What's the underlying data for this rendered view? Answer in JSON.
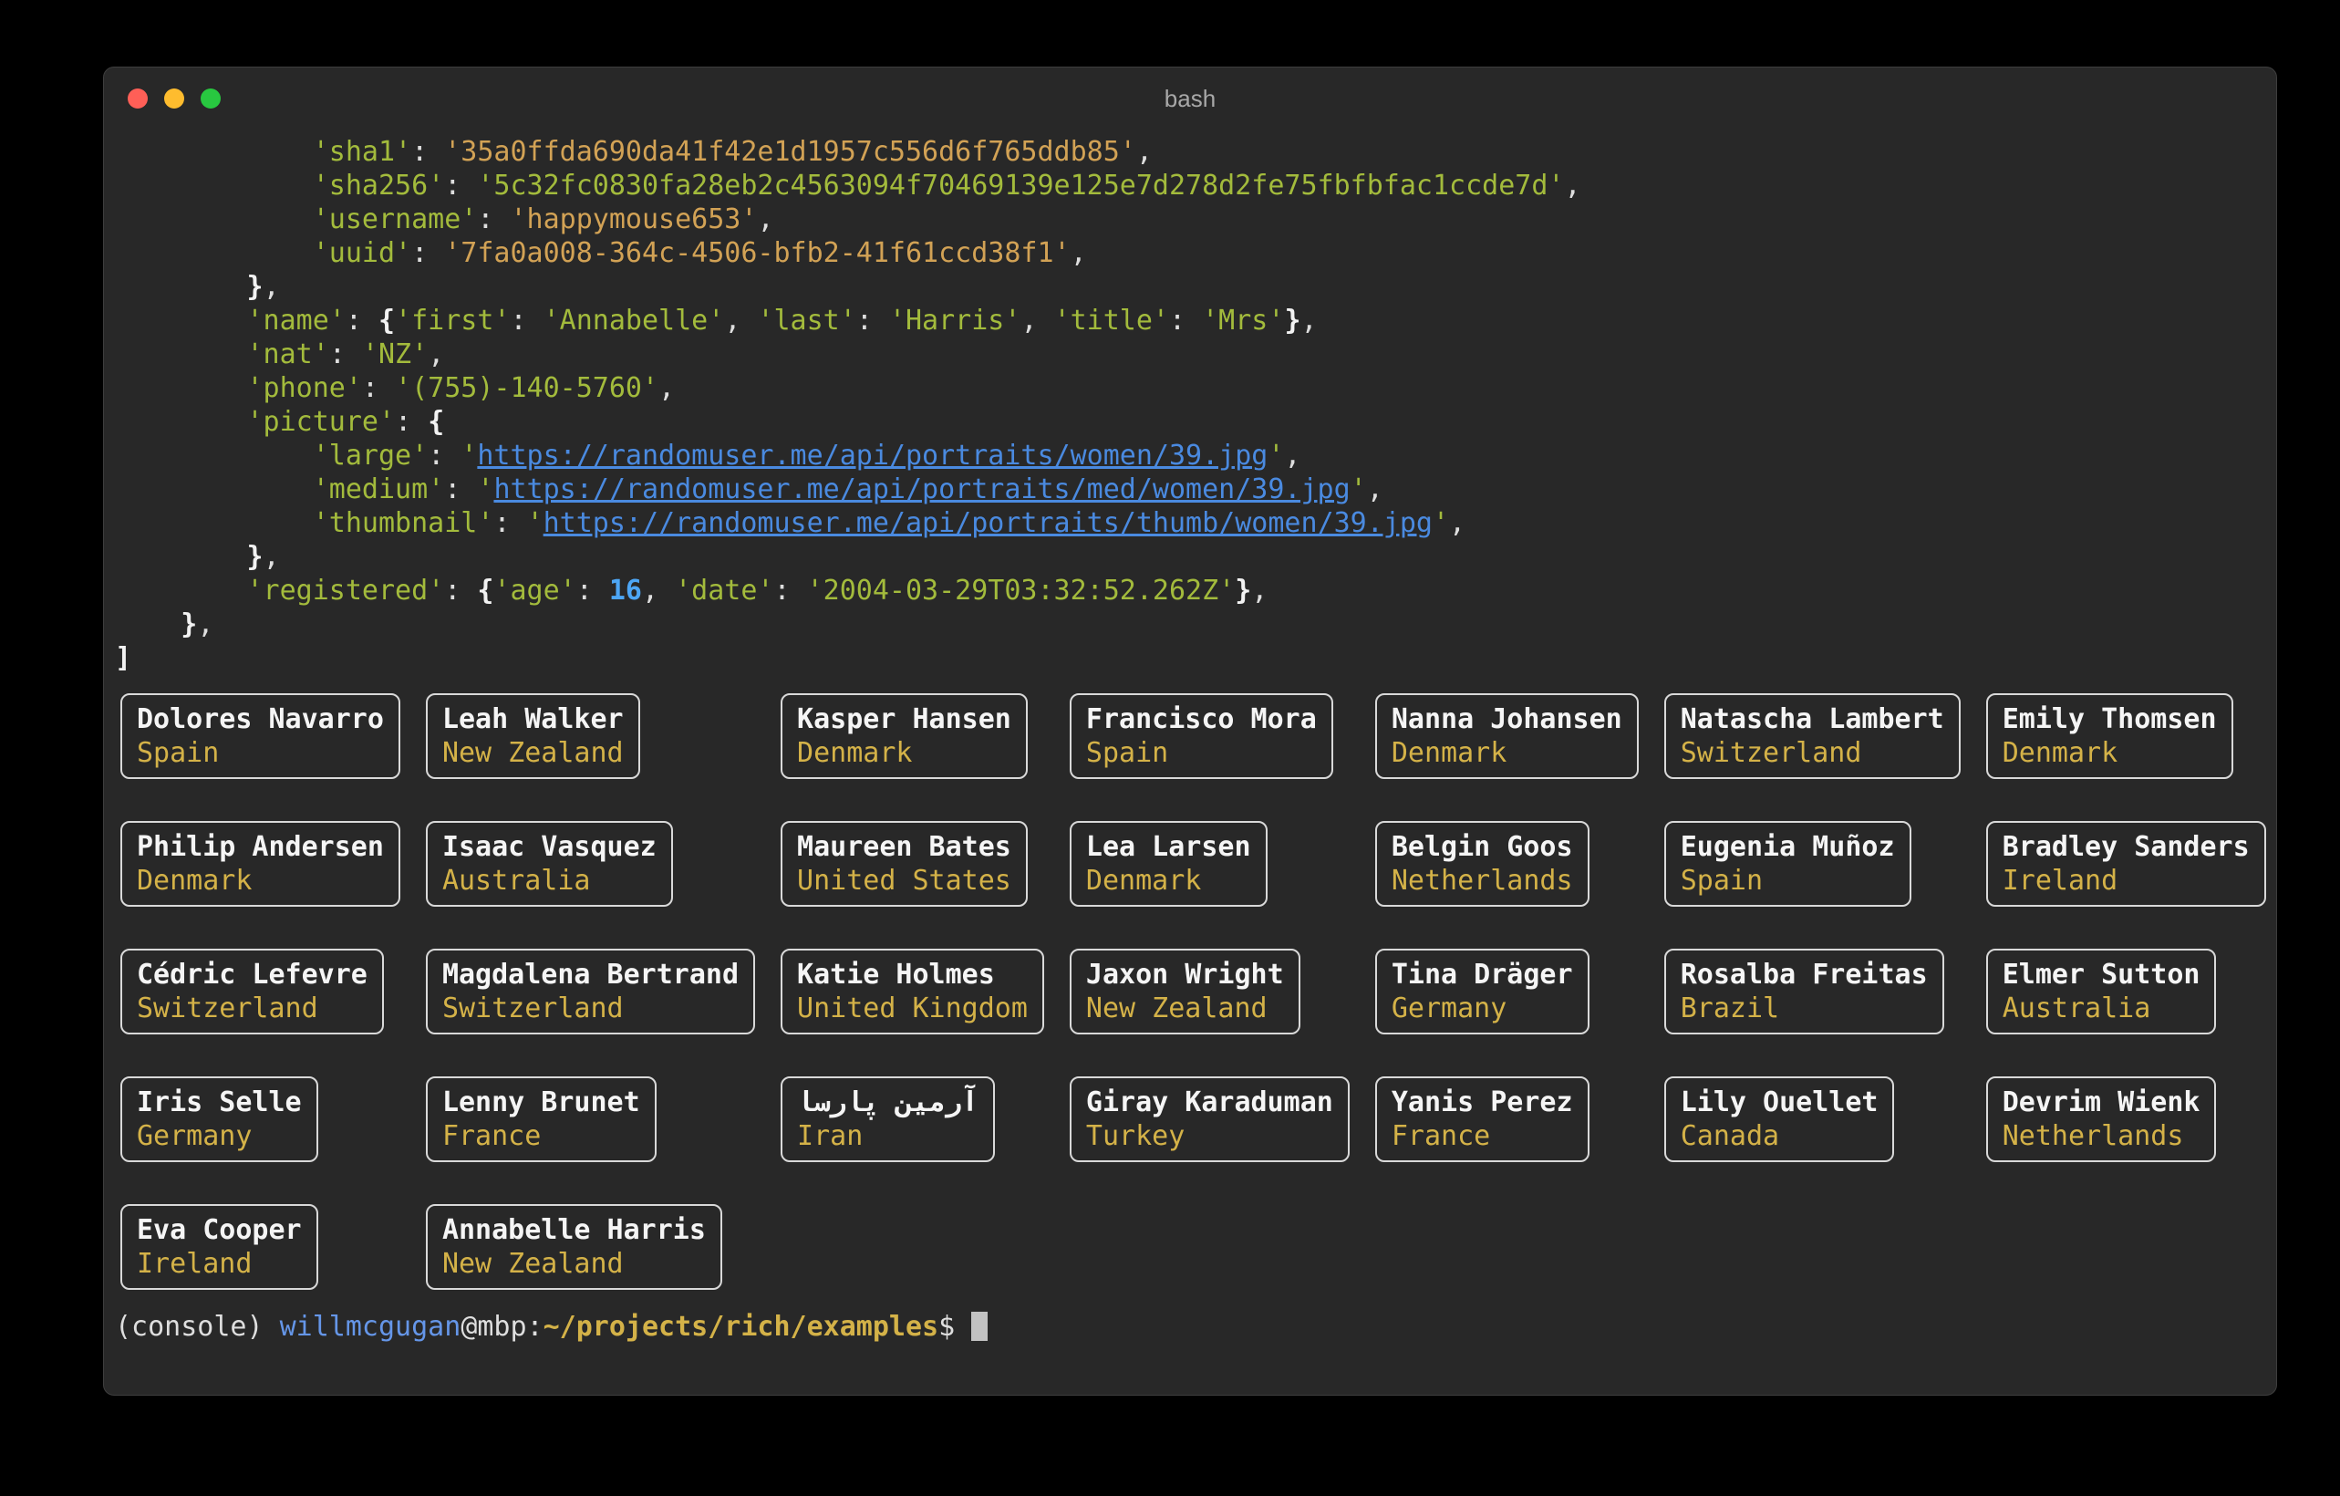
{
  "window": {
    "title": "bash"
  },
  "colors": {
    "background": "#000000",
    "terminal_bg": "#282828",
    "foreground": "#dedede",
    "green": "#a3bb3c",
    "amber": "#d2a255",
    "gold": "#d4b248",
    "number_blue": "#4da6f5",
    "url_blue": "#4a8ae0",
    "user_blue": "#6596e8",
    "card_border": "#d9d9d9",
    "name_white": "#f5f5f5",
    "title_gray": "#a8a8a8",
    "cursor": "#c2c2c2",
    "traffic_red": "#ff5f57",
    "traffic_yellow": "#febc2e",
    "traffic_green": "#28c840"
  },
  "terminal": {
    "output_lines": [
      [
        {
          "s": "plain",
          "t": "            "
        },
        {
          "s": "key",
          "t": "'sha1'"
        },
        {
          "s": "plain",
          "t": ": "
        },
        {
          "s": "amber",
          "t": "'35a0ffda690da41f42e1d1957c556d6f765ddb85'"
        },
        {
          "s": "plain",
          "t": ","
        }
      ],
      [
        {
          "s": "plain",
          "t": "            "
        },
        {
          "s": "key",
          "t": "'sha256'"
        },
        {
          "s": "plain",
          "t": ": "
        },
        {
          "s": "str",
          "t": "'5c32fc0830fa28eb2c4563094f70469139e125e7d278d2fe75fbfbfac1ccde7d'"
        },
        {
          "s": "plain",
          "t": ","
        }
      ],
      [
        {
          "s": "plain",
          "t": "            "
        },
        {
          "s": "key",
          "t": "'username'"
        },
        {
          "s": "plain",
          "t": ": "
        },
        {
          "s": "amber",
          "t": "'happymouse653'"
        },
        {
          "s": "plain",
          "t": ","
        }
      ],
      [
        {
          "s": "plain",
          "t": "            "
        },
        {
          "s": "key",
          "t": "'uuid'"
        },
        {
          "s": "plain",
          "t": ": "
        },
        {
          "s": "amber",
          "t": "'7fa0a008-364c-4506-bfb2-41f61ccd38f1'"
        },
        {
          "s": "plain",
          "t": ","
        }
      ],
      [
        {
          "s": "plain",
          "t": "        "
        },
        {
          "s": "brace",
          "t": "}"
        },
        {
          "s": "plain",
          "t": ","
        }
      ],
      [
        {
          "s": "plain",
          "t": "        "
        },
        {
          "s": "key",
          "t": "'name'"
        },
        {
          "s": "plain",
          "t": ": "
        },
        {
          "s": "brace",
          "t": "{"
        },
        {
          "s": "key",
          "t": "'first'"
        },
        {
          "s": "plain",
          "t": ": "
        },
        {
          "s": "str",
          "t": "'Annabelle'"
        },
        {
          "s": "plain",
          "t": ", "
        },
        {
          "s": "key",
          "t": "'last'"
        },
        {
          "s": "plain",
          "t": ": "
        },
        {
          "s": "str",
          "t": "'Harris'"
        },
        {
          "s": "plain",
          "t": ", "
        },
        {
          "s": "key",
          "t": "'title'"
        },
        {
          "s": "plain",
          "t": ": "
        },
        {
          "s": "str",
          "t": "'Mrs'"
        },
        {
          "s": "brace",
          "t": "}"
        },
        {
          "s": "plain",
          "t": ","
        }
      ],
      [
        {
          "s": "plain",
          "t": "        "
        },
        {
          "s": "key",
          "t": "'nat'"
        },
        {
          "s": "plain",
          "t": ": "
        },
        {
          "s": "str",
          "t": "'NZ'"
        },
        {
          "s": "plain",
          "t": ","
        }
      ],
      [
        {
          "s": "plain",
          "t": "        "
        },
        {
          "s": "key",
          "t": "'phone'"
        },
        {
          "s": "plain",
          "t": ": "
        },
        {
          "s": "str",
          "t": "'(755)-140-5760'"
        },
        {
          "s": "plain",
          "t": ","
        }
      ],
      [
        {
          "s": "plain",
          "t": "        "
        },
        {
          "s": "key",
          "t": "'picture'"
        },
        {
          "s": "plain",
          "t": ": "
        },
        {
          "s": "brace",
          "t": "{"
        }
      ],
      [
        {
          "s": "plain",
          "t": "            "
        },
        {
          "s": "key",
          "t": "'large'"
        },
        {
          "s": "plain",
          "t": ": "
        },
        {
          "s": "str",
          "t": "'"
        },
        {
          "s": "url",
          "t": "https://randomuser.me/api/portraits/women/39.jpg"
        },
        {
          "s": "str",
          "t": "'"
        },
        {
          "s": "plain",
          "t": ","
        }
      ],
      [
        {
          "s": "plain",
          "t": "            "
        },
        {
          "s": "key",
          "t": "'medium'"
        },
        {
          "s": "plain",
          "t": ": "
        },
        {
          "s": "str",
          "t": "'"
        },
        {
          "s": "url",
          "t": "https://randomuser.me/api/portraits/med/women/39.jpg"
        },
        {
          "s": "str",
          "t": "'"
        },
        {
          "s": "plain",
          "t": ","
        }
      ],
      [
        {
          "s": "plain",
          "t": "            "
        },
        {
          "s": "key",
          "t": "'thumbnail'"
        },
        {
          "s": "plain",
          "t": ": "
        },
        {
          "s": "str",
          "t": "'"
        },
        {
          "s": "url",
          "t": "https://randomuser.me/api/portraits/thumb/women/39.jpg"
        },
        {
          "s": "str",
          "t": "'"
        },
        {
          "s": "plain",
          "t": ","
        }
      ],
      [
        {
          "s": "plain",
          "t": "        "
        },
        {
          "s": "brace",
          "t": "}"
        },
        {
          "s": "plain",
          "t": ","
        }
      ],
      [
        {
          "s": "plain",
          "t": "        "
        },
        {
          "s": "key",
          "t": "'registered'"
        },
        {
          "s": "plain",
          "t": ": "
        },
        {
          "s": "brace",
          "t": "{"
        },
        {
          "s": "key",
          "t": "'age'"
        },
        {
          "s": "plain",
          "t": ": "
        },
        {
          "s": "num",
          "t": "16"
        },
        {
          "s": "plain",
          "t": ", "
        },
        {
          "s": "key",
          "t": "'date'"
        },
        {
          "s": "plain",
          "t": ": "
        },
        {
          "s": "str",
          "t": "'2004-03-29T03:32:52.262Z'"
        },
        {
          "s": "brace",
          "t": "}"
        },
        {
          "s": "plain",
          "t": ","
        }
      ],
      [
        {
          "s": "plain",
          "t": "    "
        },
        {
          "s": "brace",
          "t": "}"
        },
        {
          "s": "plain",
          "t": ","
        }
      ],
      [
        {
          "s": "brace",
          "t": "]"
        }
      ]
    ],
    "prompt": [
      {
        "s": "plain",
        "t": "(console) "
      },
      {
        "s": "user",
        "t": "willmcgugan"
      },
      {
        "s": "plain",
        "t": "@mbp:"
      },
      {
        "s": "path",
        "t": "~/projects/rich/examples"
      },
      {
        "s": "plain",
        "t": "$ "
      }
    ],
    "cursor": " "
  },
  "cards": [
    {
      "name": "Dolores Navarro",
      "country": "Spain"
    },
    {
      "name": "Leah Walker",
      "country": "New Zealand"
    },
    {
      "name": "Kasper Hansen",
      "country": "Denmark"
    },
    {
      "name": "Francisco Mora",
      "country": "Spain"
    },
    {
      "name": "Nanna Johansen",
      "country": "Denmark"
    },
    {
      "name": "Natascha Lambert",
      "country": "Switzerland"
    },
    {
      "name": "Emily Thomsen",
      "country": "Denmark"
    },
    {
      "name": "Philip Andersen",
      "country": "Denmark"
    },
    {
      "name": "Isaac Vasquez",
      "country": "Australia"
    },
    {
      "name": "Maureen Bates",
      "country": "United States"
    },
    {
      "name": "Lea Larsen",
      "country": "Denmark"
    },
    {
      "name": "Belgin Goos",
      "country": "Netherlands"
    },
    {
      "name": "Eugenia Muñoz",
      "country": "Spain"
    },
    {
      "name": "Bradley Sanders",
      "country": "Ireland"
    },
    {
      "name": "Cédric Lefevre",
      "country": "Switzerland"
    },
    {
      "name": "Magdalena Bertrand",
      "country": "Switzerland"
    },
    {
      "name": "Katie Holmes",
      "country": "United Kingdom"
    },
    {
      "name": "Jaxon Wright",
      "country": "New Zealand"
    },
    {
      "name": "Tina Dräger",
      "country": "Germany"
    },
    {
      "name": "Rosalba Freitas",
      "country": "Brazil"
    },
    {
      "name": "Elmer Sutton",
      "country": "Australia"
    },
    {
      "name": "Iris Selle",
      "country": "Germany"
    },
    {
      "name": "Lenny Brunet",
      "country": "France"
    },
    {
      "name": "آرمین پارسا",
      "country": "Iran"
    },
    {
      "name": "Giray Karaduman",
      "country": "Turkey"
    },
    {
      "name": "Yanis Perez",
      "country": "France"
    },
    {
      "name": "Lily Ouellet",
      "country": "Canada"
    },
    {
      "name": "Devrim Wienk",
      "country": "Netherlands"
    },
    {
      "name": "Eva Cooper",
      "country": "Ireland"
    },
    {
      "name": "Annabelle Harris",
      "country": "New Zealand"
    }
  ]
}
